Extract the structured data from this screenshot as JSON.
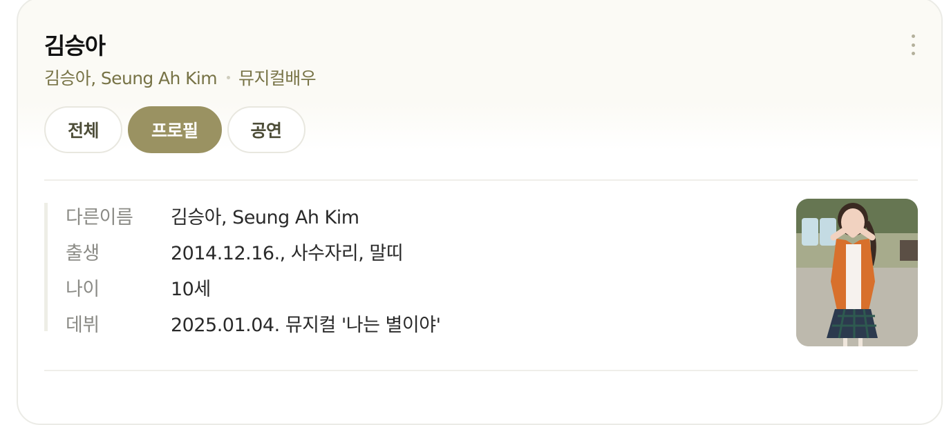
{
  "header": {
    "title": "김승아",
    "alias": "김승아, Seung Ah Kim",
    "occupation": "뮤지컬배우"
  },
  "tabs": [
    {
      "label": "전체",
      "active": false
    },
    {
      "label": "프로필",
      "active": true
    },
    {
      "label": "공연",
      "active": false
    }
  ],
  "profile": {
    "rows": [
      {
        "label": "다른이름",
        "value": "김승아, Seung Ah Kim"
      },
      {
        "label": "출생",
        "value": "2014.12.16., 사수자리, 말띠"
      },
      {
        "label": "나이",
        "value": "10세"
      },
      {
        "label": "데뷔",
        "value": "2025.01.04. 뮤지컬 '나는 별이야'"
      }
    ]
  },
  "colors": {
    "accent": "#9a9262",
    "subtitle": "#777346",
    "header_bg": "#fbfaf5"
  },
  "icons": {
    "more": "more-vertical-icon"
  }
}
